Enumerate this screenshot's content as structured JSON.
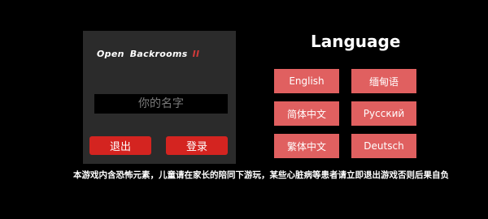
{
  "panel": {
    "logo": {
      "word1": "Open",
      "word2": "Backrooms",
      "word3": "II"
    },
    "name_input": {
      "placeholder": "你的名字",
      "value": ""
    },
    "exit_label": "退出",
    "login_label": "登录"
  },
  "language": {
    "title": "Language",
    "options": [
      "English",
      "缅甸语",
      "简体中文",
      "Русский",
      "繁体中文",
      "Deutsch"
    ]
  },
  "disclaimer": "本游戏内含恐怖元素，儿童请在家长的陪同下游玩，某些心脏病等患者请立即退出游戏否则后果自负",
  "colors": {
    "background": "#000000",
    "panel": "#2b2b2b",
    "panel_button": "#d42420",
    "language_button": "#e06060",
    "input_bg": "#000000"
  }
}
